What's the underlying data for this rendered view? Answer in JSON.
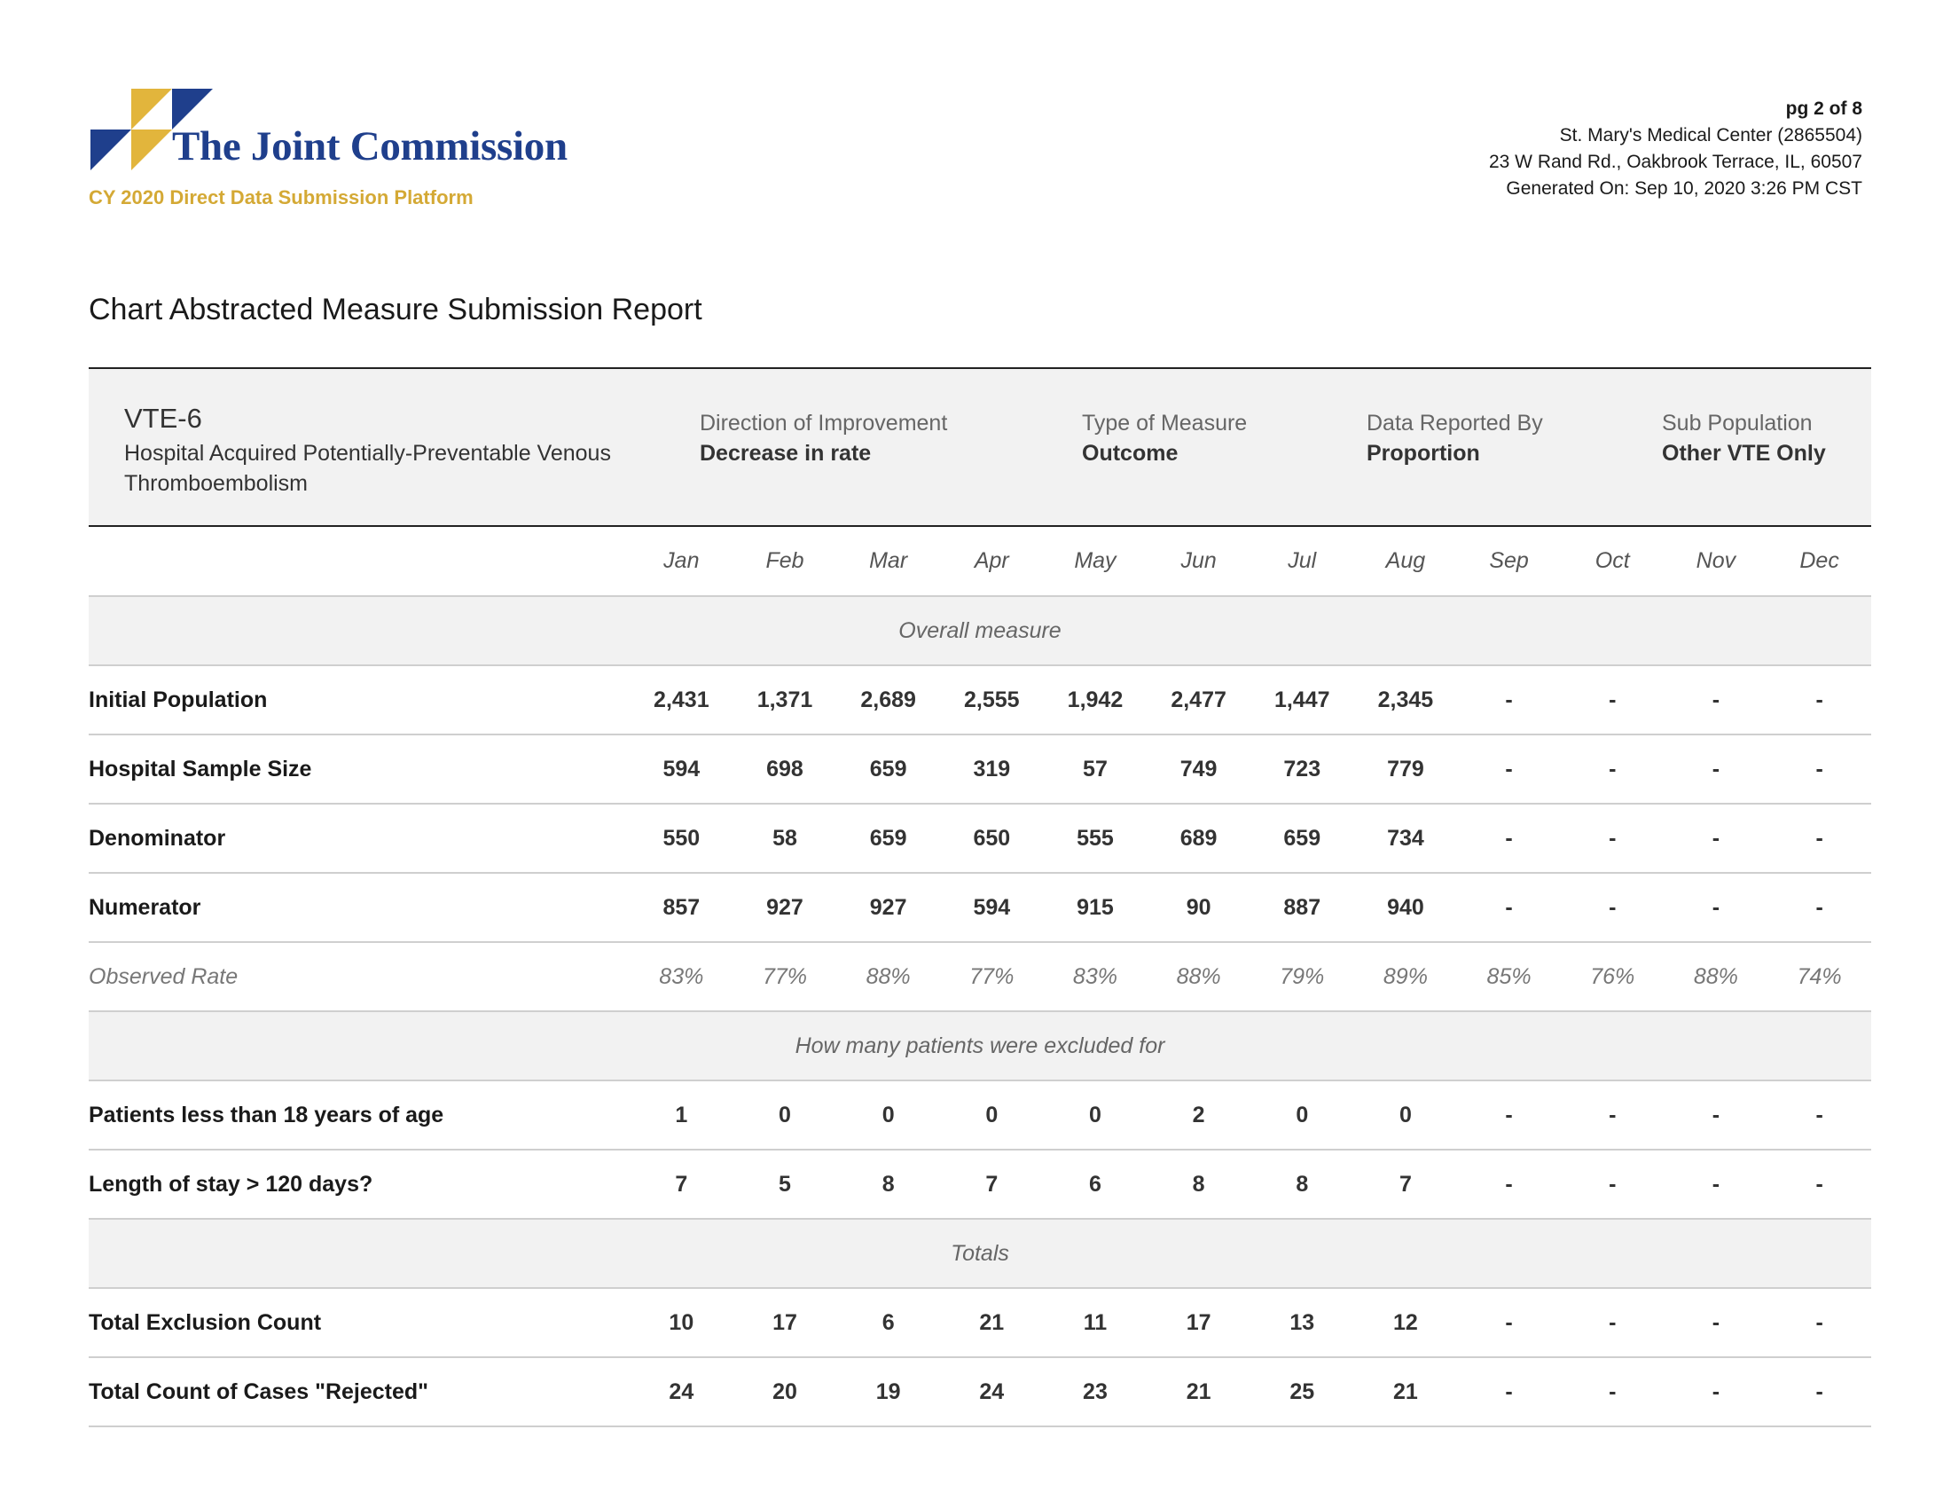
{
  "header": {
    "logo_text": "The Joint Commission",
    "platform": "CY 2020 Direct Data Submission Platform",
    "page": "pg 2 of 8",
    "facility": "St. Mary's Medical Center (2865504)",
    "address": "23 W Rand Rd., Oakbrook Terrace, IL, 60507",
    "generated": "Generated On: Sep 10, 2020 3:26 PM CST",
    "colors": {
      "navy": "#1f3f8c",
      "gold": "#e2b53c"
    }
  },
  "report_title": "Chart Abstracted Measure Submission Report",
  "measure": {
    "code": "VTE-6",
    "name": "Hospital Acquired Potentially-Preventable Venous Thromboembolism",
    "direction_label": "Direction of Improvement",
    "direction_value": "Decrease in rate",
    "type_label": "Type of Measure",
    "type_value": "Outcome",
    "reported_label": "Data Reported By",
    "reported_value": "Proportion",
    "subpop_label": "Sub Population",
    "subpop_value": "Other VTE Only"
  },
  "table": {
    "months": [
      "Jan",
      "Feb",
      "Mar",
      "Apr",
      "May",
      "Jun",
      "Jul",
      "Aug",
      "Sep",
      "Oct",
      "Nov",
      "Dec"
    ],
    "sections": [
      {
        "title": "Overall measure",
        "rows": [
          {
            "label": "Initial Population",
            "values": [
              "2,431",
              "1,371",
              "2,689",
              "2,555",
              "1,942",
              "2,477",
              "1,447",
              "2,345",
              "-",
              "-",
              "-",
              "-"
            ]
          },
          {
            "label": "Hospital Sample Size",
            "values": [
              "594",
              "698",
              "659",
              "319",
              "57",
              "749",
              "723",
              "779",
              "-",
              "-",
              "-",
              "-"
            ]
          },
          {
            "label": "Denominator",
            "values": [
              "550",
              "58",
              "659",
              "650",
              "555",
              "689",
              "659",
              "734",
              "-",
              "-",
              "-",
              "-"
            ]
          },
          {
            "label": "Numerator",
            "values": [
              "857",
              "927",
              "927",
              "594",
              "915",
              "90",
              "887",
              "940",
              "-",
              "-",
              "-",
              "-"
            ]
          },
          {
            "label": "Observed Rate",
            "observed": true,
            "values": [
              "83%",
              "77%",
              "88%",
              "77%",
              "83%",
              "88%",
              "79%",
              "89%",
              "85%",
              "76%",
              "88%",
              "74%"
            ]
          }
        ]
      },
      {
        "title": "How many patients were excluded for",
        "rows": [
          {
            "label": "Patients less than 18 years of age",
            "values": [
              "1",
              "0",
              "0",
              "0",
              "0",
              "2",
              "0",
              "0",
              "-",
              "-",
              "-",
              "-"
            ]
          },
          {
            "label": "Length of stay > 120 days?",
            "values": [
              "7",
              "5",
              "8",
              "7",
              "6",
              "8",
              "8",
              "7",
              "-",
              "-",
              "-",
              "-"
            ]
          }
        ]
      },
      {
        "title": "Totals",
        "rows": [
          {
            "label": "Total Exclusion Count",
            "values": [
              "10",
              "17",
              "6",
              "21",
              "11",
              "17",
              "13",
              "12",
              "-",
              "-",
              "-",
              "-"
            ]
          },
          {
            "label": "Total Count of Cases \"Rejected\"",
            "values": [
              "24",
              "20",
              "19",
              "24",
              "23",
              "21",
              "25",
              "21",
              "-",
              "-",
              "-",
              "-"
            ]
          }
        ]
      }
    ]
  }
}
